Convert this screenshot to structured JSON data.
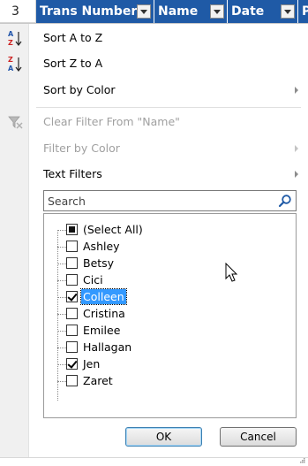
{
  "header": {
    "row_number": "3",
    "columns": [
      {
        "label": "Trans Number"
      },
      {
        "label": "Name"
      },
      {
        "label": "Date"
      },
      {
        "label": "P"
      }
    ]
  },
  "menu": {
    "sort_az": "Sort A to Z",
    "sort_za": "Sort Z to A",
    "sort_by_color": "Sort by Color",
    "clear_filter": "Clear Filter From \"Name\"",
    "filter_by_color": "Filter by Color",
    "text_filters": "Text Filters"
  },
  "search": {
    "placeholder": "Search"
  },
  "list": {
    "items": [
      {
        "label": "(Select All)",
        "state": "partial"
      },
      {
        "label": "Ashley",
        "state": "unchecked"
      },
      {
        "label": "Betsy",
        "state": "unchecked"
      },
      {
        "label": "Cici",
        "state": "unchecked"
      },
      {
        "label": "Colleen",
        "state": "checked"
      },
      {
        "label": "Cristina",
        "state": "unchecked"
      },
      {
        "label": "Emilee",
        "state": "unchecked"
      },
      {
        "label": "Hallagan",
        "state": "unchecked"
      },
      {
        "label": "Jen",
        "state": "checked"
      },
      {
        "label": "Zaret",
        "state": "unchecked"
      }
    ]
  },
  "buttons": {
    "ok": "OK",
    "cancel": "Cancel"
  },
  "colors": {
    "header_blue": "#1f5aa6",
    "selection_blue": "#3399ff",
    "gutter": "#f0f0f0"
  },
  "icons": {
    "sort_az": "sort-ascending-icon",
    "sort_za": "sort-descending-icon",
    "clear_filter": "clear-filter-icon",
    "search": "magnifier-icon"
  }
}
